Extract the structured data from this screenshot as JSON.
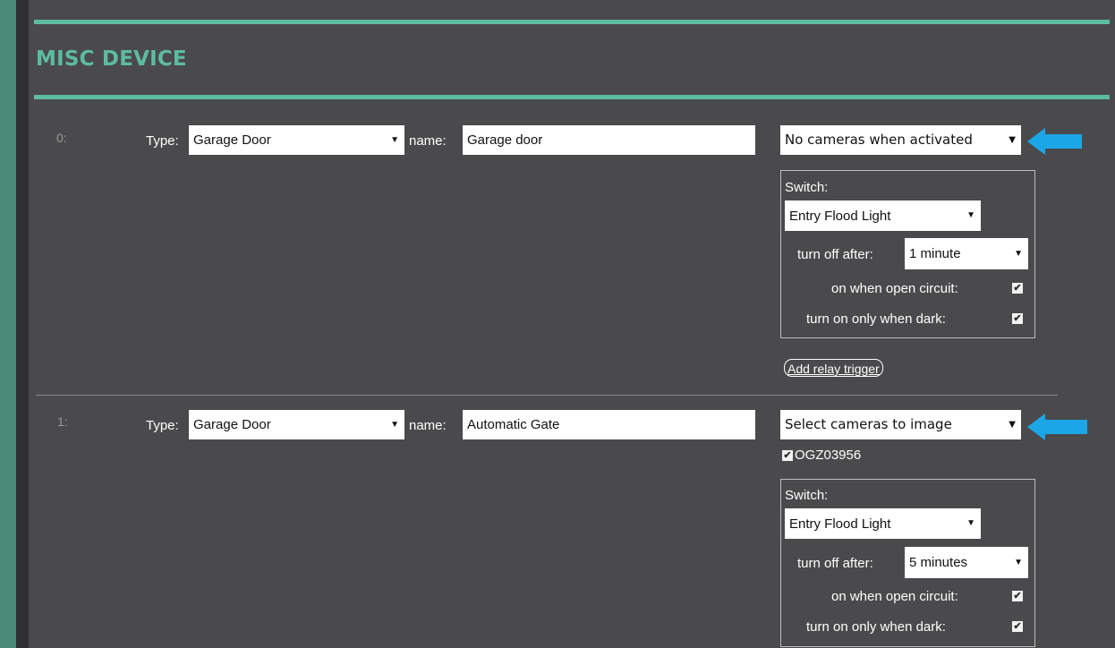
{
  "section_title": "MISC DEVICE",
  "devices": [
    {
      "index": "0:",
      "type_label": "Type:",
      "type_value": "Garage Door",
      "name_label": "name:",
      "name_value": "Garage door",
      "camera_select": "No cameras when activated",
      "switch": {
        "label": "Switch:",
        "value": "Entry Flood Light",
        "turn_off_label": "turn off after:",
        "turn_off_value": "1 minute",
        "open_circuit_label": "on when open circuit:",
        "open_circuit_checked": true,
        "dark_label": "turn on only when dark:",
        "dark_checked": true
      },
      "relay_button": "Add relay trigger"
    },
    {
      "index": "1:",
      "type_label": "Type:",
      "type_value": "Garage Door",
      "name_label": "name:",
      "name_value": "Automatic Gate",
      "camera_select": "Select cameras to image",
      "camera_option": "OGZ03956",
      "camera_option_checked": true,
      "switch": {
        "label": "Switch:",
        "value": "Entry Flood Light",
        "turn_off_label": "turn off after:",
        "turn_off_value": "5 minutes",
        "open_circuit_label": "on when open circuit:",
        "open_circuit_checked": true,
        "dark_label": "turn on only when dark:",
        "dark_checked": true
      }
    }
  ],
  "icons": {
    "caret": "caret-down-icon",
    "check": "checkbox-checked-icon",
    "pointer": "arrow-left-icon"
  },
  "colors": {
    "accent": "#5dbc9e",
    "panel": "#4a4a4c",
    "frame": "#4a8a76",
    "pointer_arrow": "#1ba6e8"
  }
}
